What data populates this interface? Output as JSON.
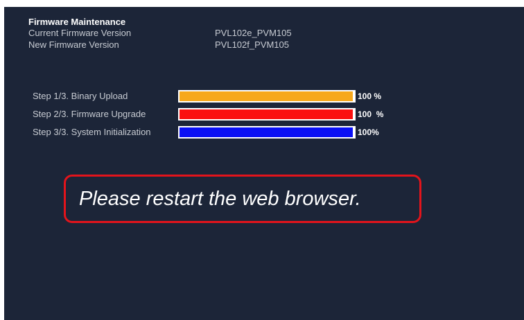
{
  "firmware": {
    "title": "Firmware Maintenance",
    "current_label": "Current Firmware Version",
    "current_value": "PVL102e_PVM105",
    "new_label": "New Firmware Version",
    "new_value": "PVL102f_PVM105"
  },
  "steps": [
    {
      "label": "Step 1/3. Binary Upload",
      "percent_text": "100 %",
      "progress": 1.0,
      "color": "#f7a81b"
    },
    {
      "label": "Step 2/3. Firmware Upgrade",
      "percent_text": "100  %",
      "progress": 1.0,
      "color": "#fb1010"
    },
    {
      "label": "Step 3/3. System Initialization",
      "percent_text": "100%",
      "progress": 1.0,
      "color": "#0a10f5"
    }
  ],
  "notice": {
    "message": "Please restart the web browser.",
    "border_color": "#e3141b"
  },
  "colors": {
    "background": "#1c2538",
    "label_text": "#c8ccd3"
  }
}
